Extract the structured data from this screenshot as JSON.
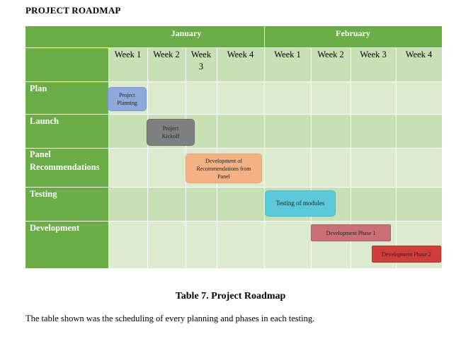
{
  "document": {
    "title": "PROJECT ROADMAP",
    "caption": "Table 7. Project Roadmap",
    "paragraph": "The table shown was the scheduling of every planning and phases in each testing."
  },
  "roadmap": {
    "months": [
      "January",
      "February"
    ],
    "weeks": [
      "Week 1",
      "Week 2",
      "Week\n3",
      "Week 4",
      "Week 1",
      "Week 2",
      "Week 3",
      "Week 4"
    ],
    "rows": [
      "Plan",
      "Launch",
      "Panel Recommendations",
      "Testing",
      "Development"
    ],
    "tasks": [
      {
        "label": "Project Planning",
        "row": "Plan",
        "start": "January Week 1",
        "end": "January Week 1"
      },
      {
        "label": "Project Kickoff",
        "row": "Launch",
        "start": "January Week 2",
        "end": "January Week 3"
      },
      {
        "label": "Development of Recommendations from Panel",
        "row": "Panel Recommendations",
        "start": "January Week 3",
        "end": "January Week 4"
      },
      {
        "label": "Testing of modules",
        "row": "Testing",
        "start": "February Week 1",
        "end": "February Week 2"
      },
      {
        "label": "Development Phase 1",
        "row": "Development",
        "start": "February Week 2",
        "end": "February Week 3"
      },
      {
        "label": "Development Phase 2",
        "row": "Development",
        "start": "February Week 4",
        "end": "February Week 4"
      }
    ],
    "colors": {
      "header": "#6aac46",
      "plan": "#8ea9db",
      "launch": "#7f7f7f",
      "panel": "#f4b183",
      "testing": "#5bc9d9",
      "dev_phase_1": "#cc7078",
      "dev_phase_2": "#cf3d3d"
    }
  }
}
